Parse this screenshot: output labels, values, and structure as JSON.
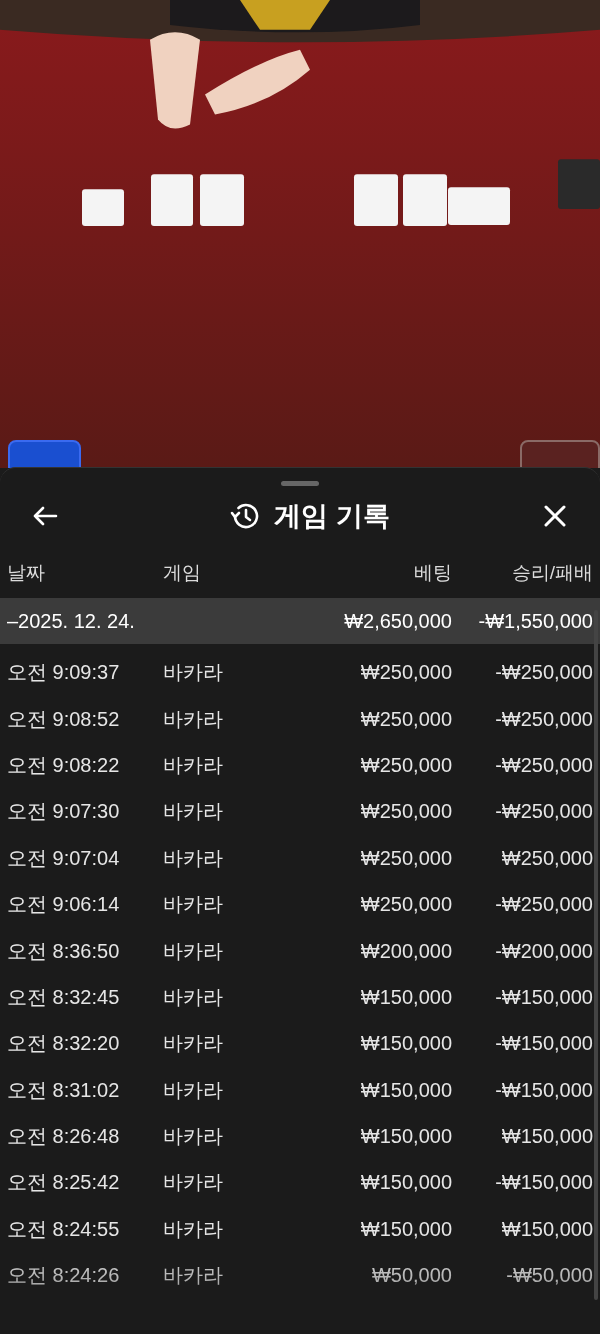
{
  "sheet": {
    "title": "게임 기록"
  },
  "columns": [
    "날짜",
    "게임",
    "베팅",
    "승리/패배"
  ],
  "group": {
    "date": "–2025. 12. 24.",
    "bet": "₩2,650,000",
    "result": "-₩1,550,000"
  },
  "rows": [
    {
      "time": "오전 9:09:37",
      "game": "바카라",
      "bet": "₩250,000",
      "result": "-₩250,000"
    },
    {
      "time": "오전 9:08:52",
      "game": "바카라",
      "bet": "₩250,000",
      "result": "-₩250,000"
    },
    {
      "time": "오전 9:08:22",
      "game": "바카라",
      "bet": "₩250,000",
      "result": "-₩250,000"
    },
    {
      "time": "오전 9:07:30",
      "game": "바카라",
      "bet": "₩250,000",
      "result": "-₩250,000"
    },
    {
      "time": "오전 9:07:04",
      "game": "바카라",
      "bet": "₩250,000",
      "result": "₩250,000"
    },
    {
      "time": "오전 9:06:14",
      "game": "바카라",
      "bet": "₩250,000",
      "result": "-₩250,000"
    },
    {
      "time": "오전 8:36:50",
      "game": "바카라",
      "bet": "₩200,000",
      "result": "-₩200,000"
    },
    {
      "time": "오전 8:32:45",
      "game": "바카라",
      "bet": "₩150,000",
      "result": "-₩150,000"
    },
    {
      "time": "오전 8:32:20",
      "game": "바카라",
      "bet": "₩150,000",
      "result": "-₩150,000"
    },
    {
      "time": "오전 8:31:02",
      "game": "바카라",
      "bet": "₩150,000",
      "result": "-₩150,000"
    },
    {
      "time": "오전 8:26:48",
      "game": "바카라",
      "bet": "₩150,000",
      "result": "₩150,000"
    },
    {
      "time": "오전 8:25:42",
      "game": "바카라",
      "bet": "₩150,000",
      "result": "-₩150,000"
    },
    {
      "time": "오전 8:24:55",
      "game": "바카라",
      "bet": "₩150,000",
      "result": "₩150,000"
    },
    {
      "time": "오전 8:24:26",
      "game": "바카라",
      "bet": "₩50,000",
      "result": "-₩50,000"
    }
  ]
}
